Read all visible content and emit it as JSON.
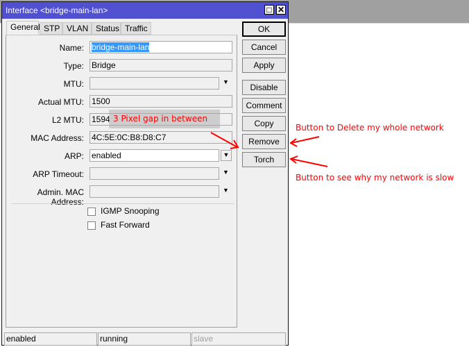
{
  "window": {
    "title": "Interface <bridge-main-lan>",
    "maximize_glyph": "□",
    "close_glyph": "✕"
  },
  "tabs": [
    {
      "label": "General",
      "active": true
    },
    {
      "label": "STP",
      "active": false
    },
    {
      "label": "VLAN",
      "active": false
    },
    {
      "label": "Status",
      "active": false
    },
    {
      "label": "Traffic",
      "active": false
    }
  ],
  "form": {
    "name": {
      "label": "Name:",
      "value": "bridge-main-lan"
    },
    "type": {
      "label": "Type:",
      "value": "Bridge"
    },
    "mtu": {
      "label": "MTU:",
      "value": ""
    },
    "actual_mtu": {
      "label": "Actual MTU:",
      "value": "1500"
    },
    "l2_mtu": {
      "label": "L2 MTU:",
      "value": "1594"
    },
    "mac_address": {
      "label": "MAC Address:",
      "value": "4C:5E:0C:B8:D8:C7"
    },
    "arp": {
      "label": "ARP:",
      "value": "enabled"
    },
    "arp_timeout": {
      "label": "ARP Timeout:",
      "value": ""
    },
    "admin_mac": {
      "label": "Admin. MAC Address:",
      "value": ""
    },
    "igmp_snooping": {
      "label": "IGMP Snooping",
      "checked": false
    },
    "fast_forward": {
      "label": "Fast Forward",
      "checked": false
    }
  },
  "buttons": {
    "ok": "OK",
    "cancel": "Cancel",
    "apply": "Apply",
    "disable": "Disable",
    "comment": "Comment",
    "copy": "Copy",
    "remove": "Remove",
    "torch": "Torch"
  },
  "statusbar": {
    "enabled": "enabled",
    "running": "running",
    "slave": "slave"
  },
  "annotations": {
    "gap_note": "3 Pixel gap in between",
    "remove_note": "Button to Delete my whole network",
    "torch_note": "Button to see why my network is slow",
    "color": "#ff0000"
  }
}
